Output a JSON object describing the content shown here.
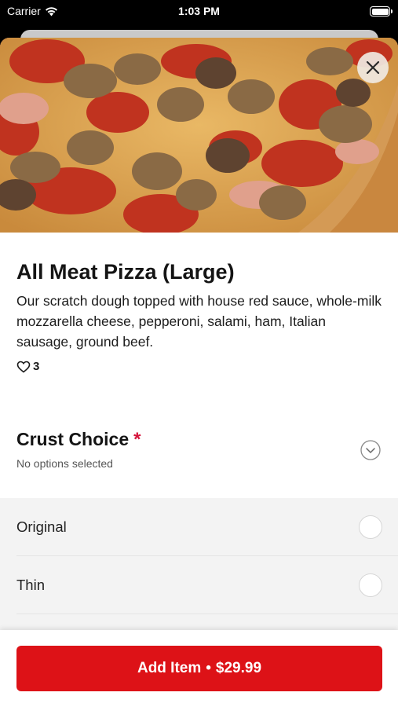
{
  "status_bar": {
    "carrier": "Carrier",
    "time": "1:03 PM"
  },
  "item": {
    "title": "All Meat Pizza (Large)",
    "description": "Our scratch dough topped with house red sauce, whole-milk mozzarella cheese, pepperoni, salami, ham, Italian sausage, ground beef.",
    "likes": "3"
  },
  "icons": {
    "close": "close-icon",
    "heart": "heart-icon",
    "chevron": "chevron-down-icon",
    "wifi": "wifi-icon",
    "battery": "battery-icon"
  },
  "crust": {
    "title": "Crust Choice",
    "required_mark": "*",
    "subtitle": "No options selected",
    "options": [
      {
        "label": "Original"
      },
      {
        "label": "Thin"
      }
    ]
  },
  "footer": {
    "button_label": "Add Item",
    "separator": "•",
    "price": "$29.99"
  },
  "colors": {
    "accent": "#dd1217",
    "required": "#d5143b"
  }
}
